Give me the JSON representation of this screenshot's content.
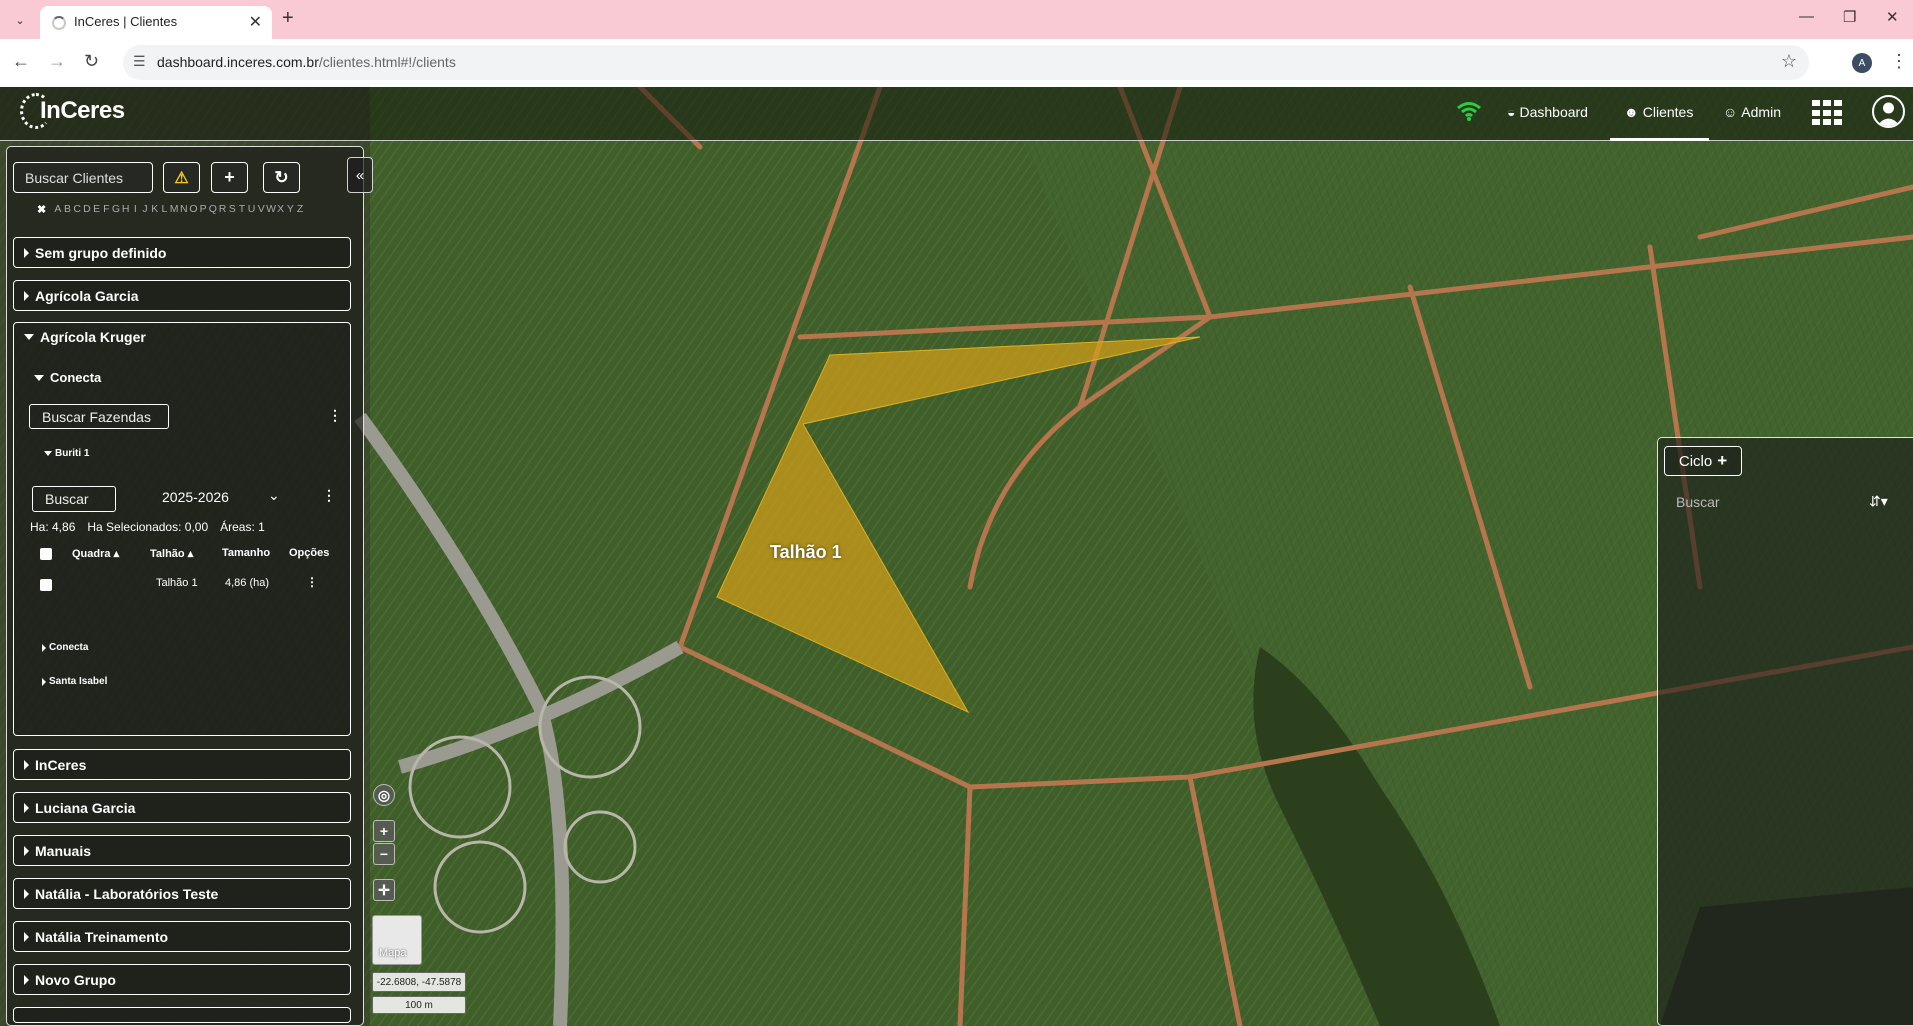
{
  "browser": {
    "tab_title": "InCeres | Clientes",
    "url_domain": "dashboard.inceres.com.br",
    "url_path": "/clientes.html#!/clients",
    "profile_initial": "A"
  },
  "nav": {
    "logo": "InCeres",
    "dashboard": "Dashboard",
    "clientes": "Clientes",
    "admin": "Admin"
  },
  "sidebar": {
    "search_placeholder": "Buscar Clientes",
    "alphabet": [
      "A",
      "B",
      "C",
      "D",
      "E",
      "F",
      "G",
      "H",
      "I",
      "J",
      "K",
      "L",
      "M",
      "N",
      "O",
      "P",
      "Q",
      "R",
      "S",
      "T",
      "U",
      "V",
      "W",
      "X",
      "Y",
      "Z"
    ],
    "groups_top": [
      "Sem grupo definido",
      "Agrícola Garcia"
    ],
    "expanded_group": "Agrícola Kruger",
    "subgroup": "Conecta",
    "farm_search_placeholder": "Buscar Fazendas",
    "farm": "Buriti 1",
    "buscar_label": "Buscar",
    "season": "2025-2026",
    "stats": {
      "ha": "Ha: 4,86",
      "ha_selected": "Ha Selecionados: 0,00",
      "areas": "Áreas: 1"
    },
    "table_headers": {
      "quadra": "Quadra",
      "talhao": "Talhão",
      "tamanho": "Tamanho",
      "opcoes": "Opções"
    },
    "table_rows": [
      {
        "talhao": "Talhão 1",
        "tamanho": "4,86 (ha)"
      }
    ],
    "other_farms": [
      "Conecta",
      "Santa Isabel"
    ],
    "groups_bottom": [
      "InCeres",
      "Luciana Garcia",
      "Manuais",
      "Natália - Laboratórios Teste",
      "Natália Treinamento",
      "Novo Grupo"
    ]
  },
  "map": {
    "field_label": "Talhão 1",
    "field_color": "#d4a017",
    "basemap_label": "Mapa",
    "coordinates": "-22.6808, -47.5878",
    "scale": "100 m"
  },
  "right_panel": {
    "ciclo_label": "Ciclo",
    "search_placeholder": "Buscar"
  }
}
